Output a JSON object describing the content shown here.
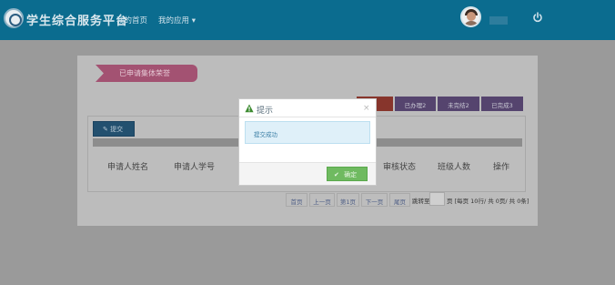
{
  "header": {
    "brand": "学生综合服务平台",
    "nav": {
      "home": "我的首页",
      "apps": "我的应用 ▾"
    }
  },
  "panel": {
    "ribbon_title": "已申请集体荣誉",
    "status_tabs": [
      "",
      "已办理2",
      "未完结2",
      "已完成3"
    ],
    "submit_label": "提交",
    "table": {
      "columns": [
        "申请人姓名",
        "申请人学号",
        "审核状态",
        "班级人数",
        "操作"
      ]
    },
    "pager": {
      "buttons": [
        "首页",
        "上一页",
        "第1页",
        "下一页",
        "尾页"
      ],
      "jump_label": "跳转至",
      "summary": "页 [每页 10行/ 共 0页/ 共 0条]"
    }
  },
  "dialog": {
    "title": "提示",
    "close": "×",
    "message": "提交成功",
    "ok_label": "确定"
  }
}
